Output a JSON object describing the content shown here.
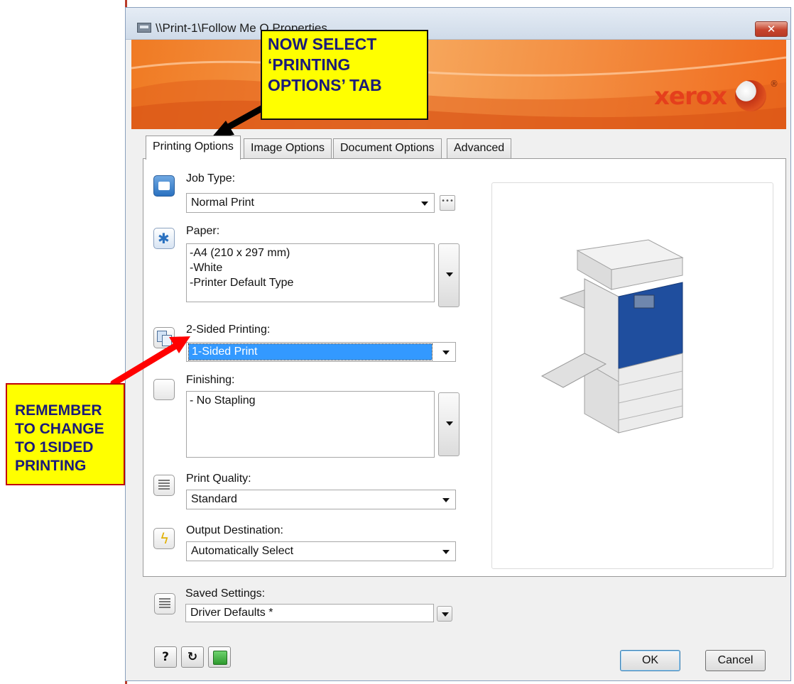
{
  "window": {
    "title": "\\\\Print-1\\Follow Me Q Properties",
    "close_label": "✕"
  },
  "banner": {
    "logo_text": "xerox",
    "logo_mark": "®"
  },
  "tabs": [
    {
      "label": "Printing Options",
      "active": true
    },
    {
      "label": "Image Options",
      "active": false
    },
    {
      "label": "Document Options",
      "active": false
    },
    {
      "label": "Advanced",
      "active": false
    }
  ],
  "job_type": {
    "label": "Job Type:",
    "value": "Normal Print",
    "more_label": "•••"
  },
  "paper": {
    "label": "Paper:",
    "lines": [
      "-A4 (210 x 297 mm)",
      "-White",
      "-Printer Default Type"
    ]
  },
  "two_sided": {
    "label": "2-Sided Printing:",
    "value": "1-Sided Print"
  },
  "finishing": {
    "label": "Finishing:",
    "lines": [
      "- No Stapling"
    ]
  },
  "print_quality": {
    "label": "Print Quality:",
    "value": "Standard"
  },
  "output_destination": {
    "label": "Output Destination:",
    "value": "Automatically Select"
  },
  "saved_settings": {
    "label": "Saved Settings:",
    "value": "Driver Defaults *"
  },
  "bottom_buttons": {
    "help": "?",
    "reset": "↻"
  },
  "dialog_buttons": {
    "ok": "OK",
    "cancel": "Cancel"
  },
  "annotations": {
    "top": "NOW SELECT\n‘PRINTING\nOPTIONS’ TAB",
    "left": "REMEMBER\nTO CHANGE\nTO 1SIDED\nPRINTING"
  },
  "colors": {
    "callout_fill": "#ffff00",
    "arrow_black": "#000000",
    "arrow_red": "#ff0000",
    "selection": "#3399ff",
    "banner": "#f07a23"
  }
}
